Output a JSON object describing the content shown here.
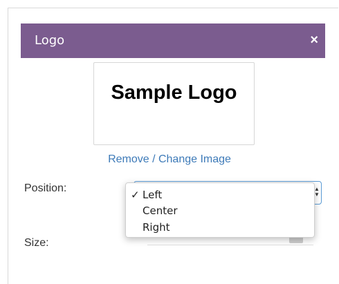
{
  "dialog": {
    "title": "Logo",
    "close_glyph": "×",
    "header_color": "#7b5c8f"
  },
  "logo": {
    "text": "Sample Logo"
  },
  "change_image_link": "Remove / Change Image",
  "position": {
    "label": "Position:",
    "selected": "Left",
    "options": [
      "Left",
      "Center",
      "Right"
    ],
    "check_glyph": "✓"
  },
  "size": {
    "label": "Size:"
  },
  "colors": {
    "link": "#3d7ab8",
    "focus_border": "#5b9bd5"
  }
}
